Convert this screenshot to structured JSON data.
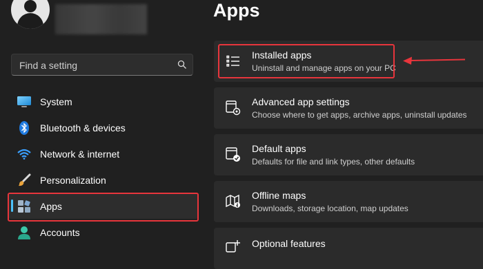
{
  "profile": {
    "avatar_icon": "user-avatar-icon"
  },
  "search": {
    "placeholder": "Find a setting",
    "icon": "search-icon"
  },
  "sidebar": {
    "items": [
      {
        "label": "System",
        "icon": "monitor-icon"
      },
      {
        "label": "Bluetooth & devices",
        "icon": "bluetooth-icon"
      },
      {
        "label": "Network & internet",
        "icon": "wifi-icon"
      },
      {
        "label": "Personalization",
        "icon": "brush-icon"
      },
      {
        "label": "Apps",
        "icon": "apps-icon",
        "selected": true
      },
      {
        "label": "Accounts",
        "icon": "person-icon"
      }
    ]
  },
  "main": {
    "title": "Apps",
    "cards": [
      {
        "title": "Installed apps",
        "subtitle": "Uninstall and manage apps on your PC",
        "icon": "list-icon"
      },
      {
        "title": "Advanced app settings",
        "subtitle": "Choose where to get apps, archive apps, uninstall updates",
        "icon": "app-settings-icon"
      },
      {
        "title": "Default apps",
        "subtitle": "Defaults for file and link types, other defaults",
        "icon": "default-apps-icon"
      },
      {
        "title": "Offline maps",
        "subtitle": "Downloads, storage location, map updates",
        "icon": "map-icon"
      },
      {
        "title": "Optional features",
        "subtitle": "",
        "icon": "add-feature-icon"
      }
    ]
  },
  "colors": {
    "background": "#202020",
    "card": "#2b2b2b",
    "accent": "#4cc2ff",
    "annotation": "#e8353c"
  }
}
